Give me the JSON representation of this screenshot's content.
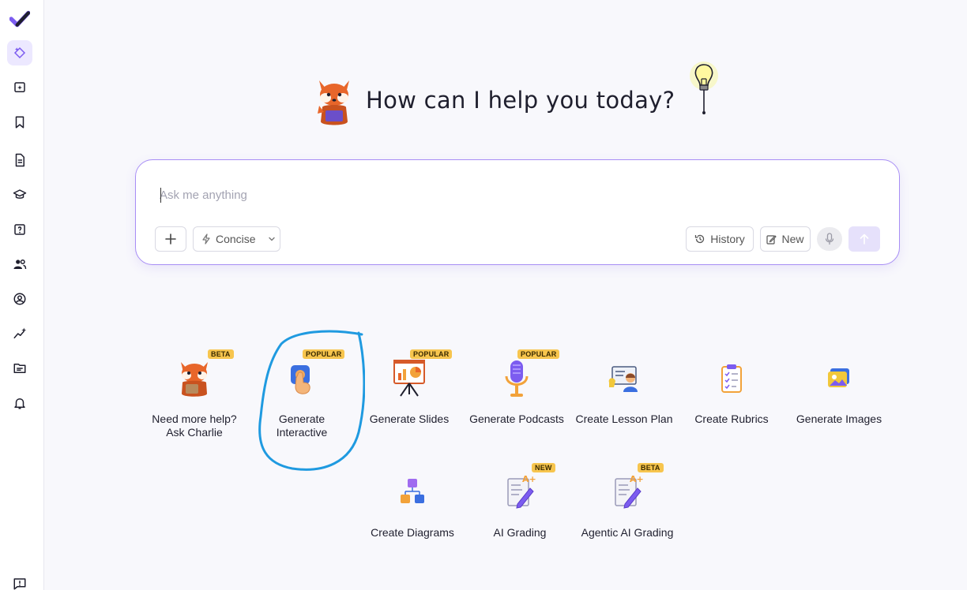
{
  "sidebar": {
    "items": [
      {
        "name": "logo",
        "icon": "brand-check-icon"
      },
      {
        "name": "chat",
        "icon": "sparkle-diamond-icon",
        "active": true
      },
      {
        "name": "new",
        "icon": "add-sparkle-icon"
      },
      {
        "name": "saved",
        "icon": "bookmark-icon"
      },
      {
        "name": "documents",
        "icon": "document-icon"
      },
      {
        "name": "courses",
        "icon": "graduation-cap-icon"
      },
      {
        "name": "quizzes",
        "icon": "question-box-icon"
      },
      {
        "name": "people",
        "icon": "users-icon"
      },
      {
        "name": "profile",
        "icon": "user-circle-icon"
      },
      {
        "name": "analytics",
        "icon": "trend-sparkle-icon"
      },
      {
        "name": "files",
        "icon": "folder-icon"
      },
      {
        "name": "notifications",
        "icon": "bell-icon"
      },
      {
        "name": "feedback",
        "icon": "feedback-icon"
      }
    ]
  },
  "hero": {
    "title": "How can I help you today?"
  },
  "composer": {
    "placeholder": "Ask me anything",
    "mode_label": "Concise",
    "history_label": "History",
    "new_label": "New"
  },
  "tools": [
    {
      "label": "Need more help?\nAsk Charlie",
      "badge": "BETA",
      "icon": "fox-mascot-icon"
    },
    {
      "label": "Generate\nInteractive",
      "badge": "POPULAR",
      "icon": "touch-hand-icon"
    },
    {
      "label": "Generate Slides",
      "badge": "POPULAR",
      "icon": "presentation-board-icon"
    },
    {
      "label": "Generate Podcasts",
      "badge": "POPULAR",
      "icon": "microphone-icon"
    },
    {
      "label": "Create Lesson Plan",
      "badge": "",
      "icon": "teacher-icon"
    },
    {
      "label": "Create Rubrics",
      "badge": "",
      "icon": "clipboard-icon"
    },
    {
      "label": "Generate Images",
      "badge": "",
      "icon": "image-icon"
    },
    {
      "label": "Create Diagrams",
      "badge": "",
      "icon": "diagram-icon"
    },
    {
      "label": "AI Grading",
      "badge": "NEW",
      "icon": "grading-pen-icon"
    },
    {
      "label": "Agentic AI Grading",
      "badge": "BETA",
      "icon": "grading-pen-icon"
    }
  ],
  "colors": {
    "accent": "#7c5cf0",
    "badge": "#f7c54e",
    "annotation": "#1f9ae0"
  }
}
